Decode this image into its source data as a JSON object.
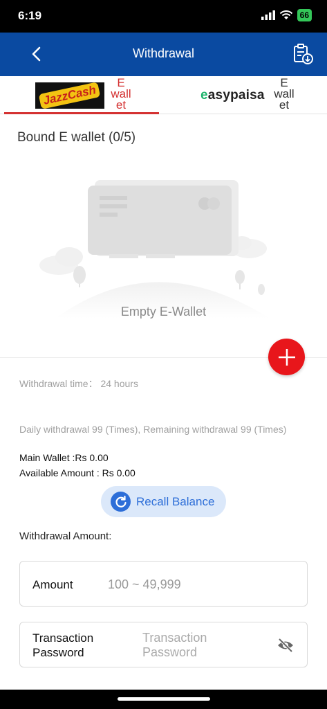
{
  "status_bar": {
    "time": "6:19",
    "battery": "66"
  },
  "header": {
    "title": "Withdrawal"
  },
  "tabs": [
    {
      "logo_text": "JazzCash",
      "label": "E wall et"
    },
    {
      "logo_text_e": "e",
      "logo_text_rest": "asypaisa",
      "label": "E wall et"
    }
  ],
  "bound": {
    "title": "Bound E wallet (0/5)",
    "empty_text": "Empty E-Wallet"
  },
  "info": {
    "withdrawal_time": "Withdrawal time：  24 hours",
    "daily_limit": "Daily withdrawal 99 (Times), Remaining withdrawal 99 (Times)",
    "main_wallet": "Main Wallet :Rs 0.00",
    "available_amount": "Available Amount : Rs 0.00"
  },
  "recall": {
    "label": "Recall Balance"
  },
  "form": {
    "heading": "Withdrawal Amount:",
    "amount_label": "Amount",
    "amount_placeholder": "100 ~ 49,999",
    "password_label": "Transaction Password",
    "password_placeholder": "Transaction Password"
  },
  "icons": {
    "back": "chevron-left-icon",
    "records": "clipboard-download-icon",
    "add": "plus-icon",
    "recall": "refresh-icon",
    "visibility": "eye-off-icon"
  },
  "colors": {
    "header_bg": "#0a4aa1",
    "active_tab": "#d43131",
    "add_button": "#e8161b",
    "recall_bg": "#dbe8fa",
    "recall_fg": "#2d6ed8"
  }
}
